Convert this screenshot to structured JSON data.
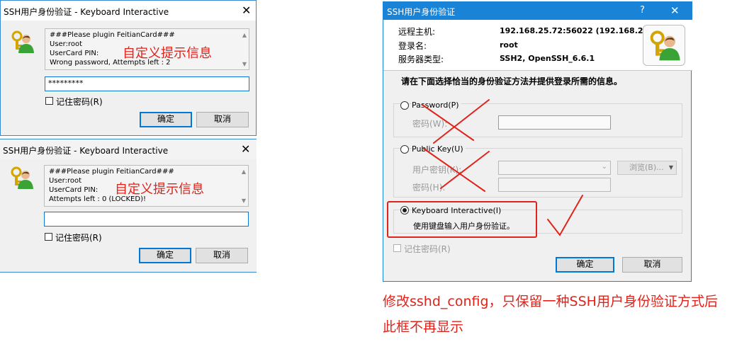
{
  "dialog1": {
    "title": "SSH用户身份验证 - Keyboard Interactive",
    "message_lines": [
      "###Please plugin FeitianCard###",
      "User:root",
      "UserCard PIN:",
      "Wrong password, Attempts left : 2"
    ],
    "annotation": "自定义提示信息",
    "input_value": "*********",
    "remember_label": "记住密码(R)",
    "ok_label": "确定",
    "cancel_label": "取消"
  },
  "dialog2": {
    "title": "SSH用户身份验证 - Keyboard Interactive",
    "message_lines": [
      "###Please plugin FeitianCard###",
      "User:root",
      "UserCard PIN:",
      "Attempts left : 0 (LOCKED)!"
    ],
    "annotation": "自定义提示信息",
    "input_value": "",
    "remember_label": "记住密码(R)",
    "ok_label": "确定",
    "cancel_label": "取消"
  },
  "dialog3": {
    "title": "SSH用户身份验证",
    "help_glyph": "?",
    "info": {
      "remote_host_label": "远程主机:",
      "remote_host_value": "192.168.25.72:56022 (192.168.25.7",
      "login_name_label": "登录名:",
      "login_name_value": "root",
      "server_type_label": "服务器类型:",
      "server_type_value": "SSH2, OpenSSH_6.6.1"
    },
    "instruction": "请在下面选择恰当的身份验证方法并提供登录所需的信息。",
    "password_option": "Password(P)",
    "password_field_label": "密码(W):",
    "pubkey_option": "Public Key(U)",
    "user_key_label": "用户密钥(K):",
    "browse_label": "浏览(B)...",
    "passphrase_label": "密码(H):",
    "kbd_option": "Keyboard Interactive(I)",
    "kbd_desc": "使用键盘输入用户身份验证。",
    "remember_label": "记住密码(R)",
    "ok_label": "确定",
    "cancel_label": "取消"
  },
  "note_lines": [
    "修改sshd_config，只保留一种SSH用户身份验证方式后",
    "此框不再显示"
  ],
  "colors": {
    "annotation_red": "#e0231b",
    "focus_blue": "#0078d7",
    "title_blue": "#1883d7"
  }
}
